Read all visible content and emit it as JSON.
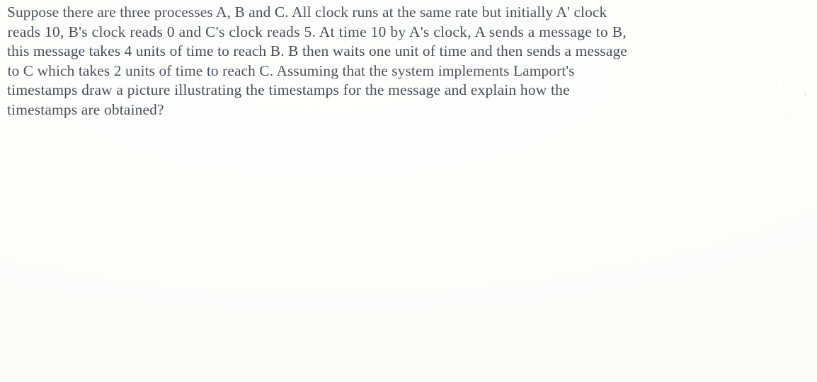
{
  "document": {
    "kind": "scanned-question",
    "text_color": "#4a5058",
    "background_color": "#ffffff",
    "body_lines": [
      "Suppose there are three processes A, B and C. All clock runs at the same rate but initially A' clock",
      "reads 10, B's clock reads 0 and C's clock reads 5. At time 10 by A's clock, A sends a message to B,",
      "this message takes 4 units of time to reach B. B then waits one unit of time and then sends a message",
      "to C which takes 2 units of time to reach C. Assuming that the system implements Lamport's",
      "timestamps draw a picture illustrating the timestamps for the message and explain how the",
      "timestamps are obtained?"
    ],
    "full_text": "Suppose there are three processes A, B and C. All clock runs at the same rate but initially A' clock reads 10, B's clock reads 0 and C's clock reads 5. At time 10 by A's clock, A sends a message to B, this message takes 4 units of time to reach B. B then waits one unit of time and then sends a message to C which takes 2 units of time to reach C. Assuming that the system implements Lamport's timestamps draw a picture illustrating the timestamps for the message and explain how the timestamps are obtained?"
  }
}
